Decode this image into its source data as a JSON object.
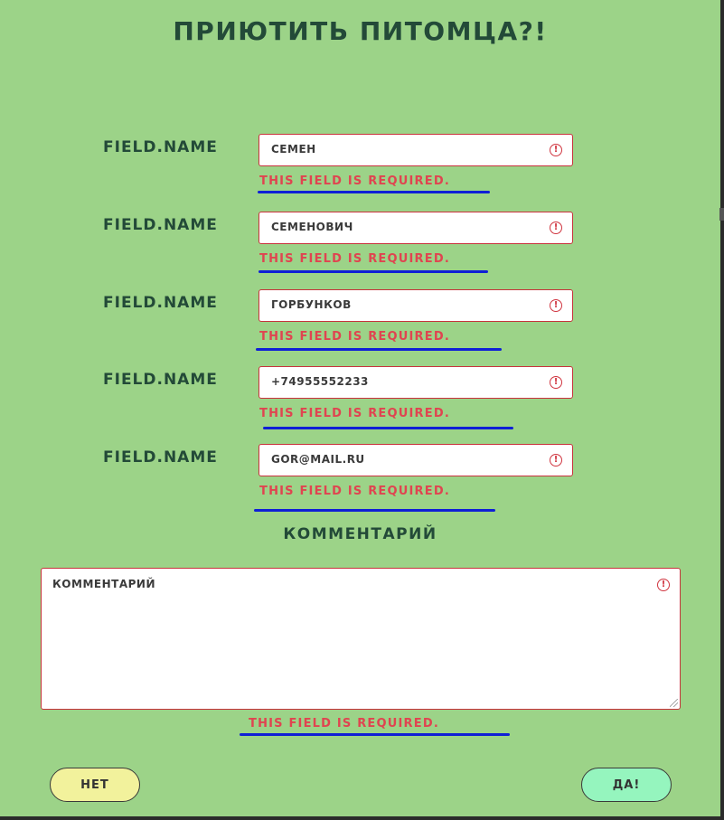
{
  "title": "Приютить питомца?!",
  "fields": [
    {
      "label": "FIELD.NAME",
      "value": "Семен",
      "error": "This field is required."
    },
    {
      "label": "FIELD.NAME",
      "value": "Семенович",
      "error": "This field is required."
    },
    {
      "label": "FIELD.NAME",
      "value": "Горбунков",
      "error": "This field is required."
    },
    {
      "label": "FIELD.NAME",
      "value": "+74955552233",
      "error": "This field is required."
    },
    {
      "label": "FIELD.NAME",
      "value": "gor@mail.ru",
      "error": "This field is required."
    }
  ],
  "comment": {
    "heading": "Комментарий",
    "value": "комментарий",
    "error": "This field is required."
  },
  "buttons": {
    "no": "Нет",
    "yes": "Да!"
  },
  "icons": {
    "error": "alert-circle-icon"
  },
  "colors": {
    "background": "#9cd388",
    "heading": "#234a38",
    "error": "#e04450",
    "underline": "#0f1fd6",
    "no_button": "#f2f29c",
    "yes_button": "#95f5be"
  }
}
